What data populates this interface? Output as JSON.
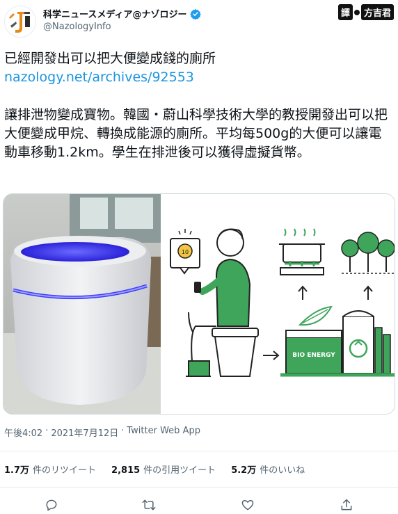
{
  "header": {
    "display_name": "科学ニュースメディア@ナゾロジー",
    "handle": "@NazologyInfo",
    "translator_prefix": "譯",
    "translator_name": "方吉君"
  },
  "tweet": {
    "title": "已經開發出可以把大便變成錢的廁所",
    "link": "nazology.net/archives/92553",
    "body": "讓排泄物變成寶物。韓國・蔚山科學技術大學的教授開發出可以把大便變成甲烷、轉換成能源的廁所。平均每500g的大便可以讓電動車移動1.2km。學生在排泄後可以獲得虛擬貨幣。"
  },
  "media": {
    "coin_label": "10",
    "bio_energy_label": "BIO ENERGY"
  },
  "meta": {
    "time": "午後4:02",
    "separator1": "·",
    "date": "2021年7月12日",
    "separator2": "·",
    "client": "Twitter Web App"
  },
  "stats": {
    "retweets_count": "1.7万",
    "retweets_label": "件のリツイート",
    "quotes_count": "2,815",
    "quotes_label": "件の引用ツイート",
    "likes_count": "5.2万",
    "likes_label": "件のいいね"
  },
  "colors": {
    "link": "#1b95e0",
    "verified": "#1d9bf0",
    "green": "#3ea55a",
    "toilet_glow": "#3b3bff"
  },
  "icons": {
    "reply": "speech-bubble-icon",
    "retweet": "retweet-arrows-icon",
    "like": "heart-icon",
    "share": "share-upload-icon"
  }
}
